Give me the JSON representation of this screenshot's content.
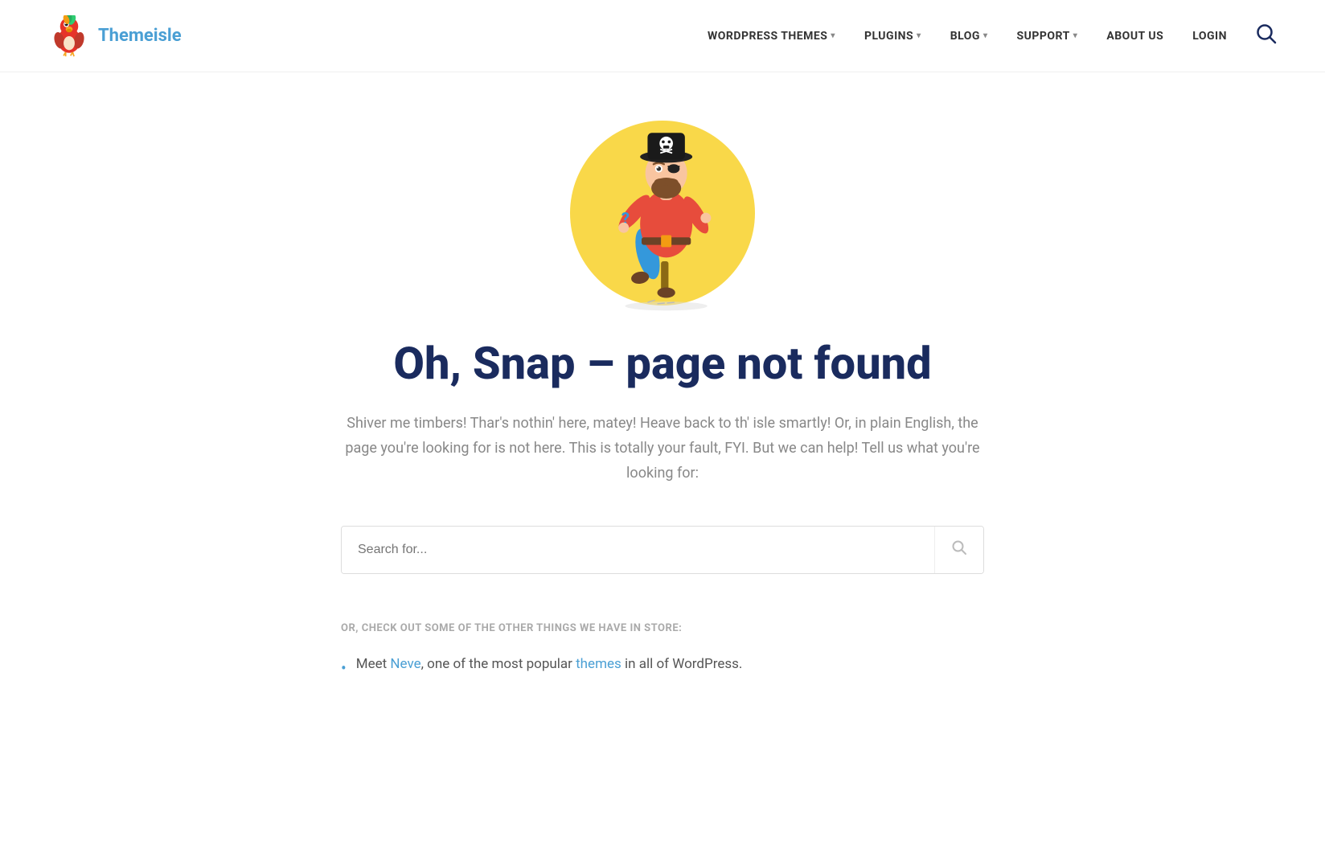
{
  "brand": {
    "name_part1": "Theme",
    "name_part2": "isle"
  },
  "nav": {
    "items": [
      {
        "label": "WORDPRESS THEMES",
        "has_dropdown": true
      },
      {
        "label": "PLUGINS",
        "has_dropdown": true
      },
      {
        "label": "BLOG",
        "has_dropdown": true
      },
      {
        "label": "SUPPORT",
        "has_dropdown": true
      },
      {
        "label": "ABOUT US",
        "has_dropdown": false
      },
      {
        "label": "LOGIN",
        "has_dropdown": false
      }
    ],
    "search_icon": "🔍"
  },
  "error_page": {
    "heading": "Oh, Snap – page not found",
    "subtext": "Shiver me timbers! Thar's nothin' here, matey! Heave back to th' isle smartly! Or, in plain English, the page you're looking for is not here. This is totally your fault, FYI. But we can help! Tell us what you're looking for:",
    "search_placeholder": "Search for...",
    "bottom_label": "OR, CHECK OUT SOME OF THE OTHER THINGS WE HAVE IN STORE:",
    "bullet": {
      "prefix": "Meet ",
      "link1_text": "Neve",
      "middle": ", one of the most popular ",
      "link2_text": "themes",
      "suffix": " in all of WordPress."
    }
  }
}
